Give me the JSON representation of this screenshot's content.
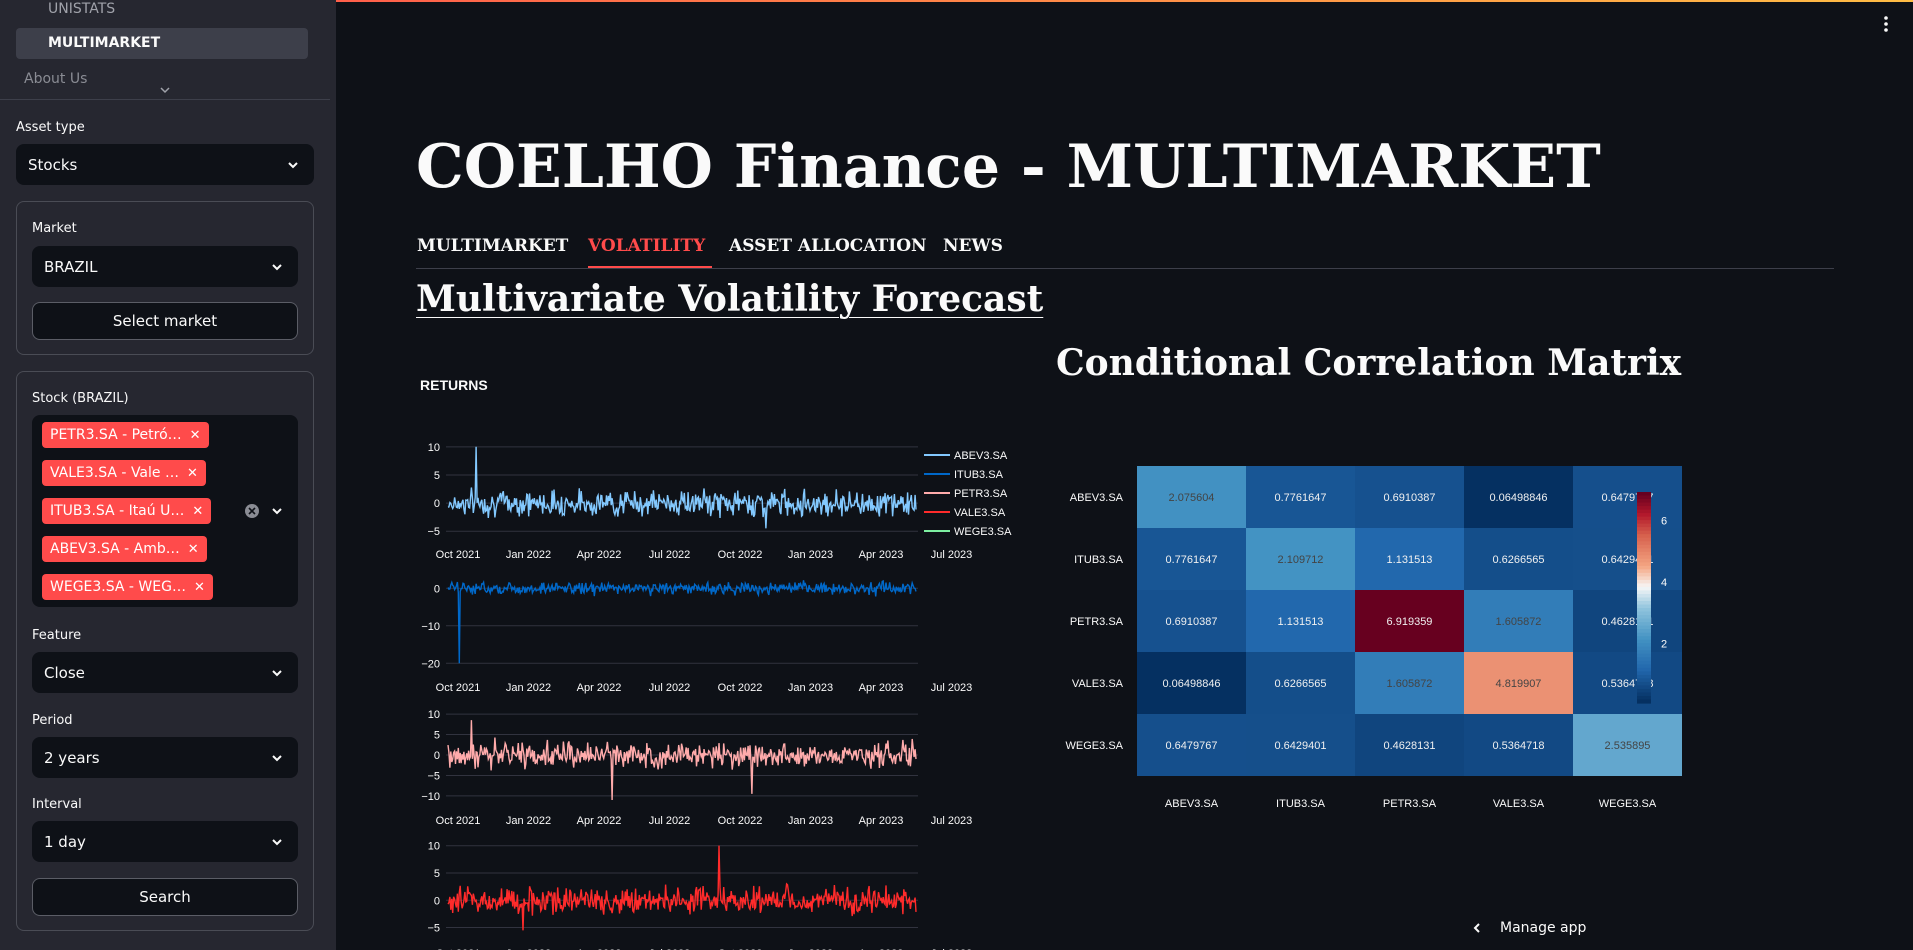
{
  "sidebar": {
    "nav": [
      {
        "label": "UNISTATS"
      },
      {
        "label": "MULTIMARKET"
      },
      {
        "label": "About Us"
      }
    ],
    "asset_type": {
      "label": "Asset type",
      "value": "Stocks"
    },
    "market": {
      "label": "Market",
      "value": "BRAZIL",
      "button": "Select market"
    },
    "stock": {
      "label": "Stock (BRAZIL)",
      "tags": [
        "PETR3.SA - Petró…",
        "VALE3.SA - Vale …",
        "ITUB3.SA - Itaú U…",
        "ABEV3.SA - Amb…",
        "WEGE3.SA - WEG…"
      ]
    },
    "feature": {
      "label": "Feature",
      "value": "Close"
    },
    "period": {
      "label": "Period",
      "value": "2 years"
    },
    "interval": {
      "label": "Interval",
      "value": "1 day"
    },
    "search_button": "Search"
  },
  "header": {
    "title": "COELHO Finance - MULTIMARKET",
    "tabs": [
      {
        "label": "MULTIMARKET",
        "active": false
      },
      {
        "label": "VOLATILITY",
        "active": true
      },
      {
        "label": "ASSET ALLOCATION",
        "active": false
      },
      {
        "label": "NEWS",
        "active": false
      }
    ],
    "section_title": "Multivariate Volatility Forecast",
    "manage_app": "Manage app"
  },
  "colors": {
    "accent": "#ff4b4b",
    "background": "#0e1117",
    "sidebar": "#262730"
  },
  "chart_data": [
    {
      "type": "line",
      "title": "RETURNS",
      "x_ticks": [
        "Oct 2021",
        "Jan 2022",
        "Apr 2022",
        "Jul 2022",
        "Oct 2022",
        "Jan 2023",
        "Apr 2023",
        "Jul 2023"
      ],
      "legend": [
        "ABEV3.SA",
        "ITUB3.SA",
        "PETR3.SA",
        "VALE3.SA",
        "WEGE3.SA"
      ],
      "legend_colors": [
        "#83c9ff",
        "#0068c9",
        "#ffabab",
        "#ff2b2b",
        "#7defa1"
      ],
      "panels": [
        {
          "series": "ABEV3.SA",
          "color": "#83c9ff",
          "y_ticks": [
            10,
            5,
            0,
            -5
          ],
          "ylim": [
            -5.5,
            10.5
          ],
          "amplitude": 2.2,
          "spikes": [
            [
              0.06,
              10
            ],
            [
              0.68,
              -4.5
            ]
          ]
        },
        {
          "series": "ITUB3.SA",
          "color": "#0068c9",
          "y_ticks": [
            0,
            -10,
            -20
          ],
          "ylim": [
            -21,
            3
          ],
          "amplitude": 1.6,
          "spikes": [
            [
              0.025,
              -20
            ]
          ]
        },
        {
          "series": "PETR3.SA",
          "color": "#ffabab",
          "y_ticks": [
            10,
            5,
            0,
            -5,
            -10
          ],
          "ylim": [
            -11,
            11
          ],
          "amplitude": 3.0,
          "spikes": [
            [
              0.35,
              -11
            ],
            [
              0.65,
              -9.5
            ],
            [
              0.05,
              8.5
            ]
          ]
        },
        {
          "series": "VALE3.SA",
          "color": "#ff2b2b",
          "y_ticks": [
            10,
            5,
            0,
            -5
          ],
          "ylim": [
            -6,
            10.5
          ],
          "amplitude": 2.4,
          "spikes": [
            [
              0.58,
              10
            ],
            [
              0.16,
              -5.5
            ]
          ]
        }
      ]
    },
    {
      "type": "heatmap",
      "title": "Conditional Correlation Matrix",
      "rows": [
        "ABEV3.SA",
        "ITUB3.SA",
        "PETR3.SA",
        "VALE3.SA",
        "WEGE3.SA"
      ],
      "cols": [
        "ABEV3.SA",
        "ITUB3.SA",
        "PETR3.SA",
        "VALE3.SA",
        "WEGE3.SA"
      ],
      "values": [
        [
          2.075604,
          0.7761647,
          0.6910387,
          0.06498846,
          0.6479767
        ],
        [
          0.7761647,
          2.109712,
          1.131513,
          0.6266565,
          0.6429401
        ],
        [
          0.6910387,
          1.131513,
          6.919359,
          1.605872,
          0.4628131
        ],
        [
          0.06498846,
          0.6266565,
          1.605872,
          4.819907,
          0.5364718
        ],
        [
          0.6479767,
          0.6429401,
          0.4628131,
          0.5364718,
          2.535895
        ]
      ],
      "labels": [
        [
          "2.075604",
          "0.7761647",
          "0.6910387",
          "0.06498846",
          "0.6479767"
        ],
        [
          "0.7761647",
          "2.109712",
          "1.131513",
          "0.6266565",
          "0.6429401"
        ],
        [
          "0.6910387",
          "1.131513",
          "6.919359",
          "1.605872",
          "0.4628131"
        ],
        [
          "0.06498846",
          "0.6266565",
          "1.605872",
          "4.819907",
          "0.5364718"
        ],
        [
          "0.6479767",
          "0.6429401",
          "0.4628131",
          "0.5364718",
          "2.535895"
        ]
      ],
      "colorscale": "RdBu_r",
      "zlim": [
        0.06,
        6.92
      ],
      "colorbar_ticks": [
        6,
        4,
        2
      ]
    }
  ]
}
